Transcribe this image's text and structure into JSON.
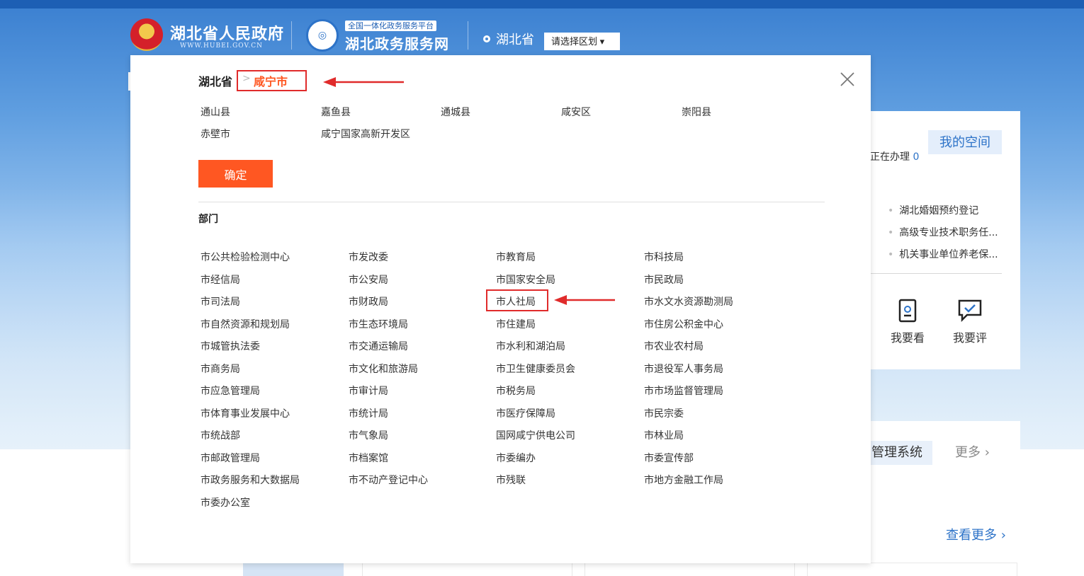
{
  "header": {
    "gov_title": "湖北省人民政府",
    "gov_sub": "WWW.HUBEI.GOV.CN",
    "svc_tag": "全国一体化政务服务平台",
    "svc_title": "湖北政务服务网",
    "location": "湖北省",
    "region_select": "请选择区划 ▾"
  },
  "modal": {
    "breadcrumb": {
      "province": "湖北省",
      "separator": ">",
      "city": "咸宁市"
    },
    "districts": [
      "通山县",
      "嘉鱼县",
      "通城县",
      "咸安区",
      "崇阳县",
      "赤壁市",
      "咸宁国家高新开发区"
    ],
    "confirm_label": "确定",
    "dept_title": "部门",
    "departments": [
      "市公共检验检测中心",
      "市发改委",
      "市教育局",
      "市科技局",
      "市经信局",
      "市公安局",
      "市国家安全局",
      "市民政局",
      "市司法局",
      "市财政局",
      "市人社局",
      "市水文水资源勘测局",
      "市自然资源和规划局",
      "市生态环境局",
      "市住建局",
      "市住房公积金中心",
      "市城管执法委",
      "市交通运输局",
      "市水利和湖泊局",
      "市农业农村局",
      "市商务局",
      "市文化和旅游局",
      "市卫生健康委员会",
      "市退役军人事务局",
      "市应急管理局",
      "市审计局",
      "市税务局",
      "市市场监督管理局",
      "市体育事业发展中心",
      "市统计局",
      "市医疗保障局",
      "市民宗委",
      "市统战部",
      "市气象局",
      "国网咸宁供电公司",
      "市林业局",
      "市邮政管理局",
      "市档案馆",
      "市委编办",
      "市委宣传部",
      "市政务服务和大数据局",
      "市不动产登记中心",
      "市残联",
      "市地方金融工作局",
      "市委办公室"
    ]
  },
  "side": {
    "doing_label": "正在办理",
    "doing_count": "0",
    "myspace": "我的空间",
    "news": [
      "湖北婚姻预约登记",
      "高级专业技术职务任...",
      "机关事业单位养老保..."
    ],
    "action_view": "我要看",
    "action_rate": "我要评",
    "system_label": "管理系统",
    "more": "更多 ›",
    "see_more": "查看更多 ›"
  },
  "colors": {
    "accent": "#ff5722",
    "highlight": "#e02b2b",
    "link": "#2d73c8"
  }
}
